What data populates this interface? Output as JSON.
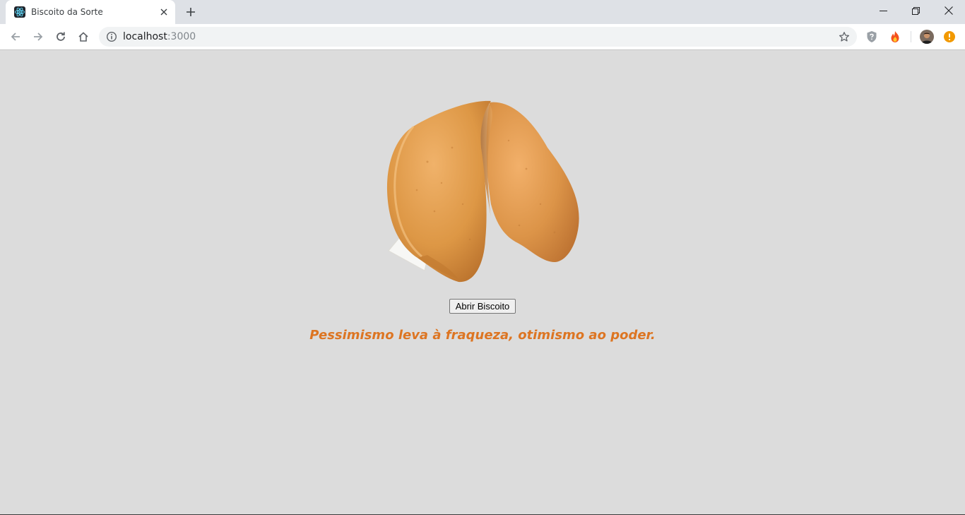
{
  "browser": {
    "tab": {
      "title": "Biscoito da Sorte",
      "favicon": "react-atom-icon"
    },
    "address_bar": {
      "host": "localhost",
      "port": ":3000"
    },
    "icons": {
      "back": "arrow-left-icon",
      "forward": "arrow-right-icon",
      "reload": "reload-icon",
      "home": "home-icon",
      "site_info": "info-icon",
      "bookmark": "star-icon",
      "extensions": [
        "shield-question-icon",
        "flame-extension-icon"
      ],
      "profile": "avatar-icon",
      "alert": "exclamation-icon"
    },
    "colors": {
      "tabstrip": "#dee1e6",
      "omnibox": "#f1f3f4",
      "alert": "#f29900"
    }
  },
  "page": {
    "background": "#dcdcdc",
    "cookie_image": "fortune-cookie-image",
    "open_button_label": "Abrir Biscoito",
    "fortune_message": "Pessimismo leva à fraqueza, otimismo ao poder.",
    "accent_color": "#dd7522"
  }
}
